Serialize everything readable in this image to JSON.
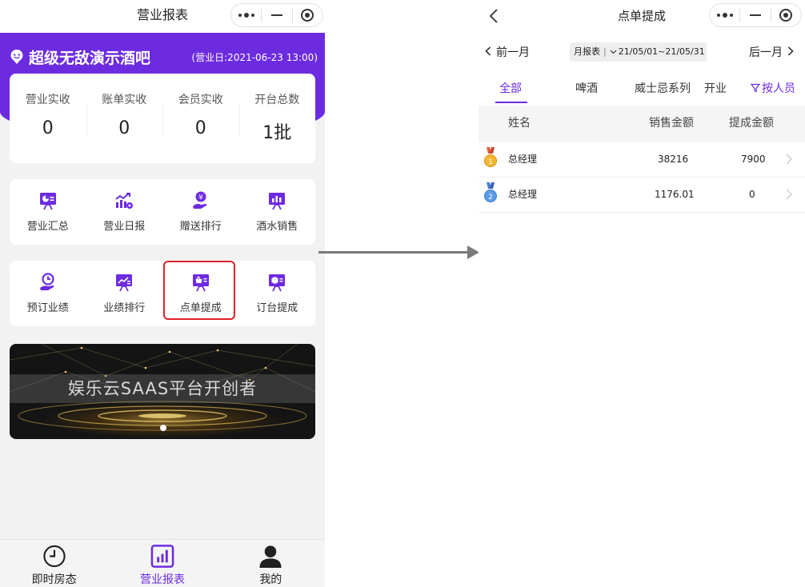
{
  "left": {
    "nav_title": "营业报表",
    "store_name": "超级无敌演示酒吧",
    "business_day": "(营业日:2021-06-23 13:00)",
    "stats": [
      {
        "label": "营业实收",
        "value": "0"
      },
      {
        "label": "账单实收",
        "value": "0"
      },
      {
        "label": "会员实收",
        "value": "0"
      },
      {
        "label": "开台总数",
        "value": "1批"
      }
    ],
    "menu1": [
      {
        "label": "营业汇总",
        "icon": "pie-board-icon"
      },
      {
        "label": "营业日报",
        "icon": "bar-trend-icon"
      },
      {
        "label": "赠送排行",
        "icon": "gift-hand-icon"
      },
      {
        "label": "酒水销售",
        "icon": "bar-chart-board-icon"
      }
    ],
    "menu2": [
      {
        "label": "预订业绩",
        "icon": "clock-hand-icon"
      },
      {
        "label": "业绩排行",
        "icon": "line-board-icon"
      },
      {
        "label": "点单提成",
        "icon": "basket-board-icon"
      },
      {
        "label": "订台提成",
        "icon": "box-board-icon"
      }
    ],
    "banner_text": "娱乐云SAAS平台开创者",
    "tabs": [
      {
        "label": "即时房态",
        "icon": "clock-icon",
        "active": false
      },
      {
        "label": "营业报表",
        "icon": "report-icon",
        "active": true
      },
      {
        "label": "我的",
        "icon": "person-icon",
        "active": false
      }
    ],
    "accent_color": "#6d2be0",
    "highlight_color": "#e0202a"
  },
  "right": {
    "nav_title": "点单提成",
    "prev_month": "前一月",
    "next_month": "后一月",
    "report_type": "月报表",
    "date_range": "21/05/01~21/05/31",
    "categories": [
      "全部",
      "啤酒",
      "威士忌系列",
      "开业"
    ],
    "active_category": "全部",
    "filter_label": "按人员",
    "columns": {
      "name": "姓名",
      "sales": "销售金额",
      "commission": "提成金额"
    },
    "rows": [
      {
        "rank": "1",
        "name": "总经理",
        "sales": "38216",
        "commission": "7900"
      },
      {
        "rank": "2",
        "name": "总经理",
        "sales": "1176.01",
        "commission": "0"
      }
    ]
  }
}
